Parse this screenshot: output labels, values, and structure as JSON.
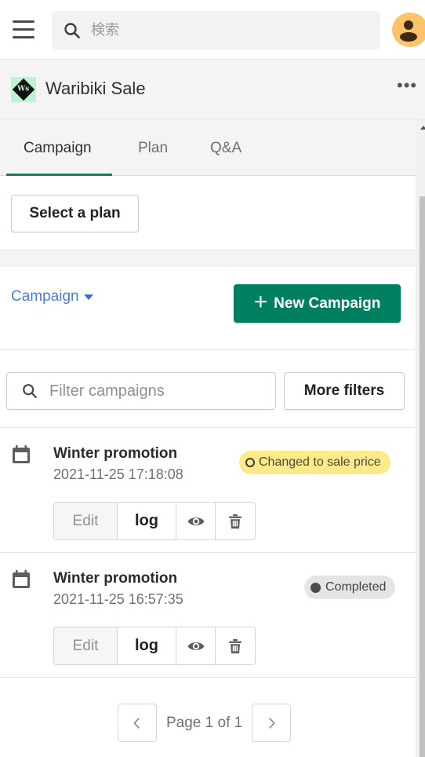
{
  "topbar": {
    "search_placeholder": "検索",
    "icons": {
      "menu": "hamburger-icon",
      "search": "search-icon",
      "avatar": "user-avatar-icon"
    }
  },
  "app": {
    "title": "Waribiki Sale",
    "logo_text": "Ws",
    "more_label": "•••"
  },
  "tabs": [
    {
      "label": "Campaign",
      "active": true
    },
    {
      "label": "Plan",
      "active": false
    },
    {
      "label": "Q&A",
      "active": false
    }
  ],
  "plan": {
    "select_label": "Select a plan"
  },
  "campaign_header": {
    "dropdown_label": "Campaign",
    "new_button_label": "New Campaign",
    "new_button_icon": "+"
  },
  "filters": {
    "placeholder": "Filter campaigns",
    "value": "",
    "more_label": "More filters"
  },
  "campaigns": [
    {
      "title": "Winter promotion",
      "date": "2021-11-25 17:18:08",
      "status": "Changed to sale price",
      "status_color": "#ffea8a",
      "actions": {
        "edit": "Edit",
        "log": "log"
      }
    },
    {
      "title": "Winter promotion",
      "date": "2021-11-25 16:57:35",
      "status": "Completed",
      "status_color": "#e4e5e7",
      "actions": {
        "edit": "Edit",
        "log": "log"
      }
    }
  ],
  "pagination": {
    "text": "Page 1 of 1",
    "current": 1,
    "total": 1
  },
  "colors": {
    "primary": "#008060",
    "tab_indicator": "#128062",
    "link": "#4a7cdc",
    "avatar_bg": "#fdc36a"
  }
}
